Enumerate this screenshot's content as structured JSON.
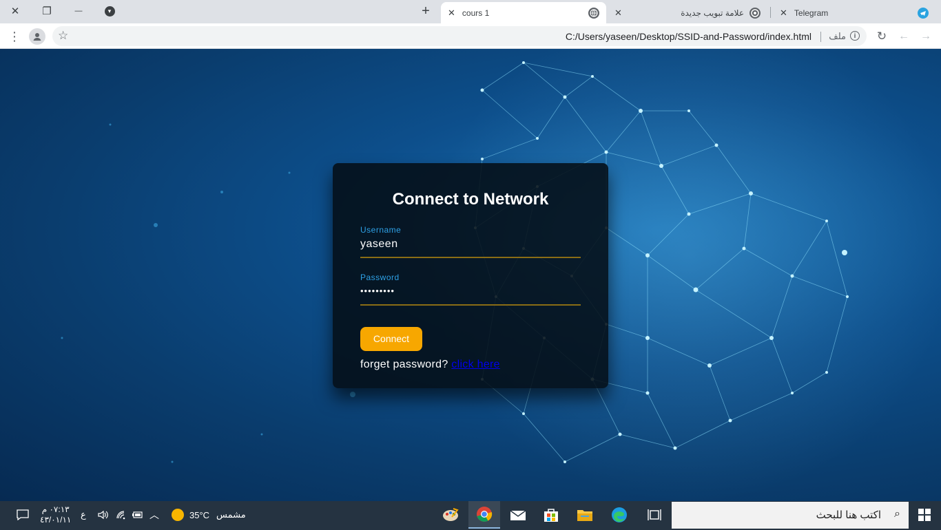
{
  "window_controls": {
    "close": "✕",
    "restore": "❐",
    "minimize": "—",
    "menu": "▾"
  },
  "tabs": [
    {
      "title": "Telegram",
      "icon": "telegram-icon",
      "active": false
    },
    {
      "title": "علامة تبويب جديدة",
      "icon": "chrome-icon",
      "active": false
    },
    {
      "title": "cours 1",
      "icon": "globe-icon",
      "active": true
    }
  ],
  "toolbar": {
    "url": "C:/Users/yaseen/Desktop/SSID-and-Password/index.html",
    "scheme_label": "ملف"
  },
  "login_card": {
    "title": "Connect to Network",
    "username_label": "Username",
    "username_value": "yaseen",
    "password_label": "Password",
    "password_masked": "•••••••••",
    "connect_label": "Connect",
    "forgot_text": "forget password?",
    "forgot_link": "click here"
  },
  "taskbar": {
    "search_placeholder": "اكتب هنا للبحث",
    "weather_temp": "35°C",
    "weather_text": "مشمس",
    "language": "ع",
    "time": "٠٧:١٣ م",
    "date": "٤٣/٠١/١١"
  },
  "colors": {
    "accent_gold": "#f7a700",
    "label_blue": "#2ea1e6",
    "card_bg": "#040e16"
  }
}
